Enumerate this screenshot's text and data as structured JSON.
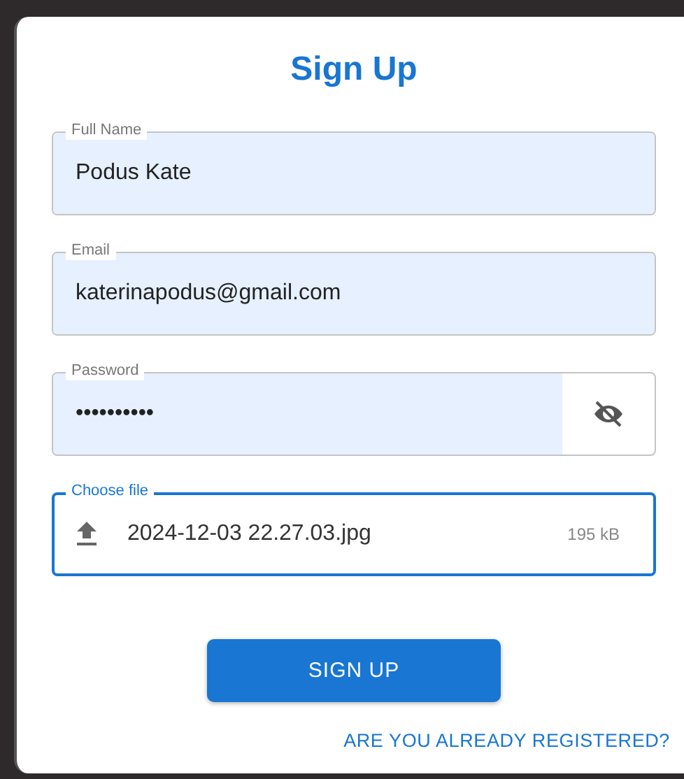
{
  "dialog": {
    "title": "Sign Up",
    "fields": [
      {
        "kind": "text",
        "label": "Full Name",
        "value": "Podus Kate",
        "autofilled": true,
        "focused": false
      },
      {
        "kind": "text",
        "label": "Email",
        "value": "katerinapodus@gmail.com",
        "autofilled": true,
        "focused": false
      },
      {
        "kind": "password",
        "label": "Password",
        "value": "••••••••••",
        "autofilled": true,
        "focused": false
      },
      {
        "kind": "file",
        "label": "Choose file",
        "value": "2024-12-03 22.27.03.jpg",
        "size": "195 kB",
        "focused": true
      }
    ],
    "submit": "SIGN UP",
    "link": "ARE YOU ALREADY REGISTERED?"
  }
}
